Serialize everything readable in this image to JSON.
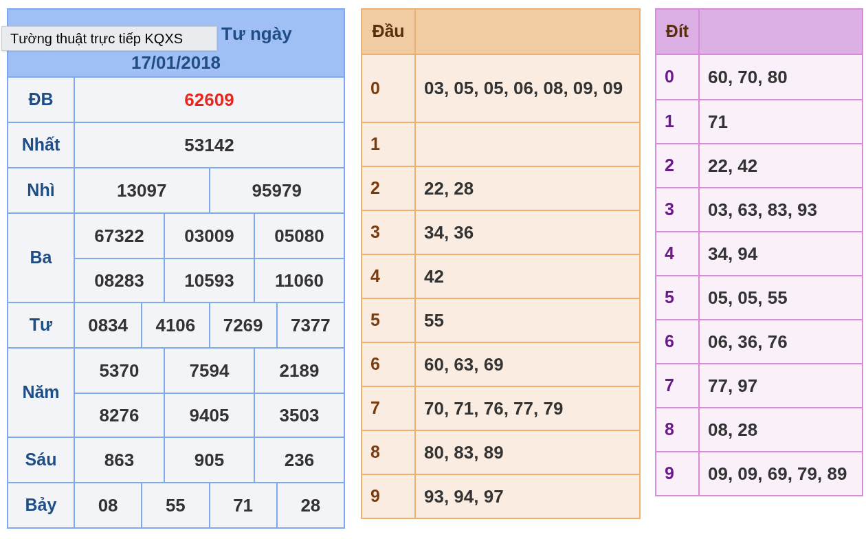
{
  "results": {
    "title_line_1": "Tư ngày",
    "title_line_2": "17/01/2018",
    "prizes": [
      {
        "name": "ĐB",
        "special": true,
        "rows": [
          [
            "62609"
          ]
        ]
      },
      {
        "name": "Nhất",
        "special": false,
        "rows": [
          [
            "53142"
          ]
        ]
      },
      {
        "name": "Nhì",
        "special": false,
        "rows": [
          [
            "13097",
            "95979"
          ]
        ]
      },
      {
        "name": "Ba",
        "special": false,
        "rows": [
          [
            "67322",
            "03009",
            "05080"
          ],
          [
            "08283",
            "10593",
            "11060"
          ]
        ]
      },
      {
        "name": "Tư",
        "special": false,
        "rows": [
          [
            "0834",
            "4106",
            "7269",
            "7377"
          ]
        ]
      },
      {
        "name": "Năm",
        "special": false,
        "rows": [
          [
            "5370",
            "7594",
            "2189"
          ],
          [
            "8276",
            "9405",
            "3503"
          ]
        ]
      },
      {
        "name": "Sáu",
        "special": false,
        "rows": [
          [
            "863",
            "905",
            "236"
          ]
        ]
      },
      {
        "name": "Bảy",
        "special": false,
        "rows": [
          [
            "08",
            "55",
            "71",
            "28"
          ]
        ]
      }
    ]
  },
  "tooltip": "Tường thuật trực tiếp KQXS",
  "dau": {
    "header": "Đầu",
    "rows": [
      {
        "key": "0",
        "values": "03, 05, 05, 06, 08, 09, 09"
      },
      {
        "key": "1"
      },
      {
        "key": "2",
        "values": "22, 28"
      },
      {
        "key": "3",
        "values": "34, 36"
      },
      {
        "key": "4",
        "values": "42"
      },
      {
        "key": "5",
        "values": "55"
      },
      {
        "key": "6",
        "values": "60, 63, 69"
      },
      {
        "key": "7",
        "values": "70, 71, 76, 77, 79"
      },
      {
        "key": "8",
        "values": "80, 83, 89"
      },
      {
        "key": "9",
        "values": "93, 94, 97"
      }
    ]
  },
  "dit": {
    "header": "Đít",
    "rows": [
      {
        "key": "0",
        "values": "60, 70, 80"
      },
      {
        "key": "1",
        "values": "71"
      },
      {
        "key": "2",
        "values": "22, 42"
      },
      {
        "key": "3",
        "values": "03, 63, 83, 93"
      },
      {
        "key": "4",
        "values": "34, 94"
      },
      {
        "key": "5",
        "values": "05, 05, 55"
      },
      {
        "key": "6",
        "values": "06, 36, 76"
      },
      {
        "key": "7",
        "values": "77, 97"
      },
      {
        "key": "8",
        "values": "08, 28"
      },
      {
        "key": "9",
        "values": "09, 09, 69, 79, 89"
      }
    ]
  }
}
